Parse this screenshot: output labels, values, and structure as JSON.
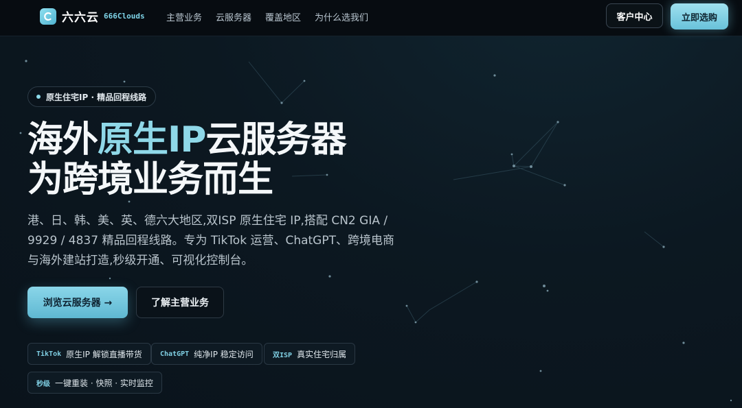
{
  "header": {
    "brand": "六六云",
    "brand_sub": "666Clouds",
    "nav": [
      "主营业务",
      "云服务器",
      "覆盖地区",
      "为什么选我们"
    ],
    "client_center": "客户中心",
    "buy_now": "立即选购",
    "logo_icon": "cloud-c-logo-icon"
  },
  "hero": {
    "pill": "原生住宅IP · 精品回程线路",
    "title_a": "海外",
    "title_hl": "原生IP",
    "title_b": "云服务器",
    "title_line2": "为跨境业务而生",
    "lead": "港、日、韩、美、英、德六大地区,双ISP 原生住宅 IP,搭配 CN2 GIA / 9929 / 4837 精品回程线路。专为 TikTok 运营、ChatGPT、跨境电商与海外建站打造,秒级开通、可视化控制台。",
    "browse_button": "浏览云服务器 →",
    "learn_button": "了解主营业务"
  },
  "chips": [
    {
      "key": "TikTok",
      "text": "原生IP 解锁直播带货"
    },
    {
      "key": "ChatGPT",
      "text": "纯净IP 稳定访问"
    },
    {
      "key": "双ISP",
      "text": "真实住宅归属"
    },
    {
      "key": "秒级",
      "text": "一键重装 · 快照 · 实时监控"
    }
  ],
  "colors": {
    "accent": "#8fd8e8",
    "background": "#0c1821",
    "header": "#070c11"
  }
}
